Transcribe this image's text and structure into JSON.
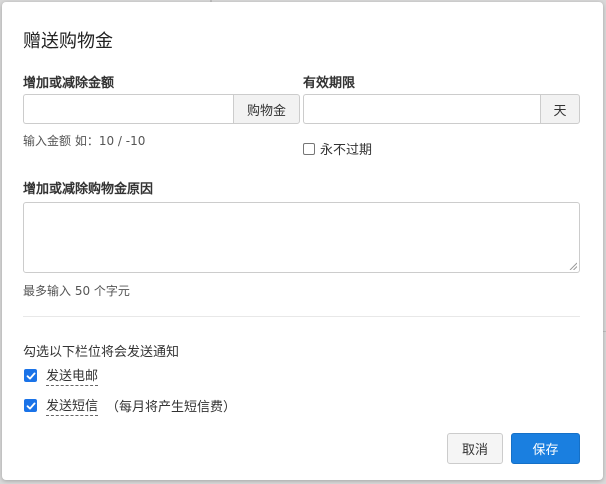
{
  "dialog": {
    "title": "赠送购物金",
    "amount": {
      "label": "增加或减除金额",
      "value": "",
      "addon": "购物金",
      "hint": "输入金额 如：10 / -10"
    },
    "validity": {
      "label": "有效期限",
      "value": "",
      "addon": "天",
      "never_expire_label": "永不过期",
      "never_expire_checked": false
    },
    "reason": {
      "label": "增加或减除购物金原因",
      "value": "",
      "hint": "最多输入 50 个字元"
    },
    "notify": {
      "label": "勾选以下栏位将会发送通知",
      "email_label": "发送电邮",
      "email_checked": true,
      "sms_label": "发送短信",
      "sms_checked": true,
      "sms_note": "（每月将产生短信费）"
    },
    "buttons": {
      "cancel": "取消",
      "save": "保存"
    }
  },
  "colors": {
    "primary": "#1a7fe0",
    "checkbox": "#1a73e8",
    "backdrop": "#d9d9d9"
  }
}
